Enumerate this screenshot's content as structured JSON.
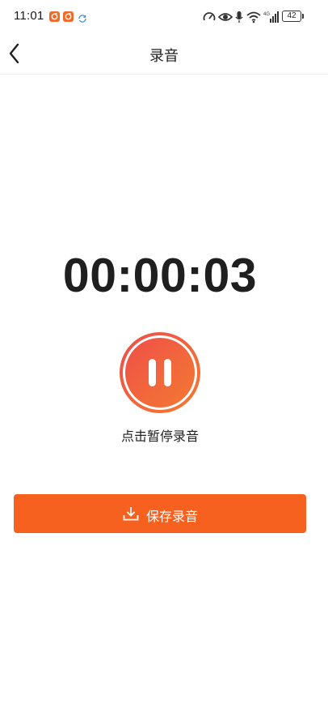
{
  "status_bar": {
    "time": "11:01",
    "battery": "42",
    "network": "4G",
    "icons": [
      "app-notification-icon",
      "app-notification-icon",
      "sync-icon",
      "speed-icon",
      "eye-icon",
      "mic-icon",
      "wifi-icon",
      "cell-signal-icon",
      "battery-icon"
    ]
  },
  "header": {
    "title": "录音",
    "back_icon": "chevron-left-icon"
  },
  "recorder": {
    "elapsed": "00:00:03",
    "hint": "点击暂停录音",
    "control_icon": "pause-icon"
  },
  "actions": {
    "save_label": "保存录音",
    "save_icon": "download-icon"
  },
  "colors": {
    "accent": "#f6611f",
    "pause_gradient_start": "#ef4b4b",
    "pause_gradient_end": "#f47a30",
    "text": "#1f1f1f",
    "divider": "#eeeeee"
  }
}
